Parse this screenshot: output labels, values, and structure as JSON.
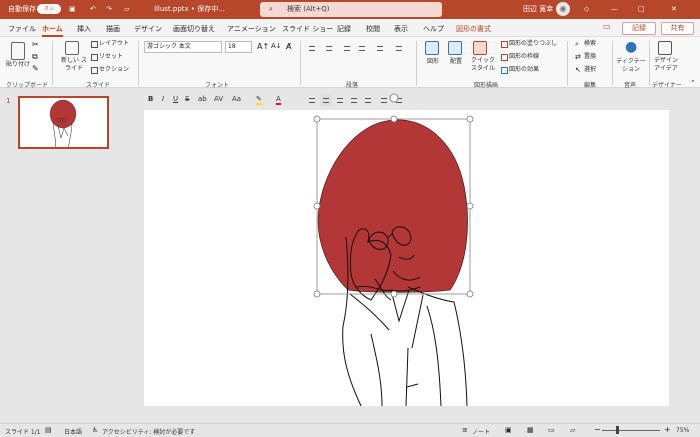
{
  "window": {
    "autosave_label": "自動保存",
    "autosave_state": "オン",
    "file_title": "illust.pptx • 保存中...",
    "search_placeholder": "検索 (Alt+Q)",
    "user_name": "田辺 寛幸"
  },
  "ribbon_tabs": [
    "ファイル",
    "ホーム",
    "挿入",
    "描画",
    "デザイン",
    "画面切り替え",
    "アニメーション",
    "スライド ショー",
    "記録",
    "校閲",
    "表示",
    "ヘルプ",
    "図形の書式"
  ],
  "record_button": "記録",
  "share_button": "共有",
  "ribbon": {
    "clipboard_group": "クリップボード",
    "paste_label": "貼り付け",
    "slides_group": "スライド",
    "new_slide_label": "新しい スライド",
    "layout_label": "レイアウト",
    "reset_label": "リセット",
    "section_label": "セクション",
    "font_group": "フォント",
    "font_name": "游ゴシック 本文",
    "font_size": "18",
    "paragraph_group": "段落",
    "drawing_group": "図形描画",
    "shape_label": "図形",
    "arrange_label": "配置",
    "quick_style_label": "クイック スタイル",
    "fill_label": "図形の塗りつぶし",
    "outline_label": "図形の枠線",
    "effects_label": "図形の効果",
    "editing_group": "編集",
    "find_label": "検索",
    "replace_label": "置換",
    "select_label": "選択",
    "voice_group": "音声",
    "dictation_label": "ディクテー ション",
    "designer_group": "デザイナー",
    "designer_label": "デザイン アイデア"
  },
  "slide": {
    "thumbnail_number": "1"
  },
  "status": {
    "slide_position": "スライド 1/1",
    "language": "日本語",
    "accessibility": "アクセシビリティ: 検討が必要です",
    "notes": "ノート",
    "zoom": "75%"
  },
  "colors": {
    "brand": "#b7472a",
    "balloon": "#b43737"
  }
}
